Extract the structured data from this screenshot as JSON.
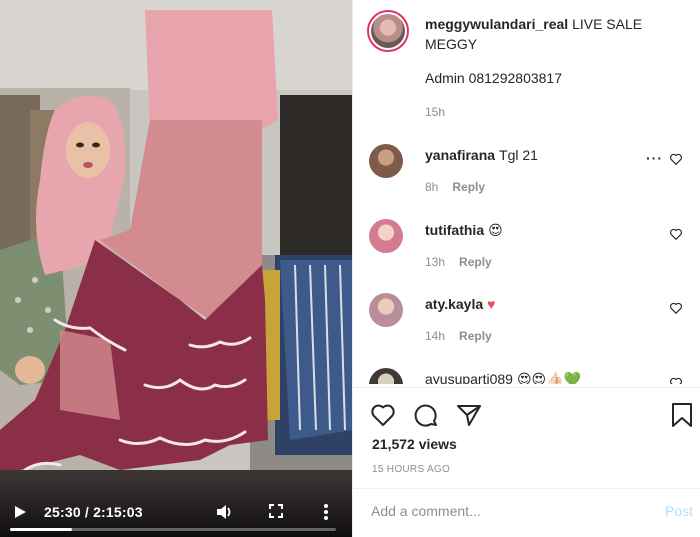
{
  "video": {
    "current_time": "25:30",
    "duration": "2:15:03",
    "time_display": "25:30 / 2:15:03",
    "progress": 0.19,
    "icons": [
      "play-icon",
      "volume-icon",
      "fullscreen-icon",
      "more-options-icon"
    ]
  },
  "caption": {
    "username": "meggywulandari_real",
    "text": "LIVE SALE MEGGY",
    "line2": "Admin 081292803817",
    "time": "15h"
  },
  "comments": [
    {
      "username": "yanafirana",
      "text": "Tgl 21",
      "emoji": "",
      "time": "8h",
      "reply": "Reply",
      "avatar_color": "#7d5b48"
    },
    {
      "username": "tutifathia",
      "text": "",
      "emoji": "😍",
      "time": "13h",
      "reply": "Reply",
      "avatar_color": "#d37b8f"
    },
    {
      "username": "aty.kayla",
      "text": "",
      "emoji": "♥",
      "time": "14h",
      "reply": "Reply",
      "avatar_color": "#b98d9a"
    },
    {
      "username": "ayusuparti089",
      "text": "",
      "emoji": "😍😍👍🏻💚",
      "time": "",
      "reply": "",
      "avatar_color": "#3f3a35"
    }
  ],
  "actions": {
    "views": "21,572 views",
    "posted": "15 HOURS AGO",
    "icons": [
      "heart-icon",
      "comment-icon",
      "share-icon",
      "bookmark-icon"
    ]
  },
  "add_comment": {
    "placeholder": "Add a comment...",
    "post_label": "Post"
  },
  "colors": {
    "link_blue_disabled": "#b2dffc",
    "muted": "#8e8e8e",
    "heart_red": "#ed4956",
    "story_ring": "#e1306c"
  }
}
